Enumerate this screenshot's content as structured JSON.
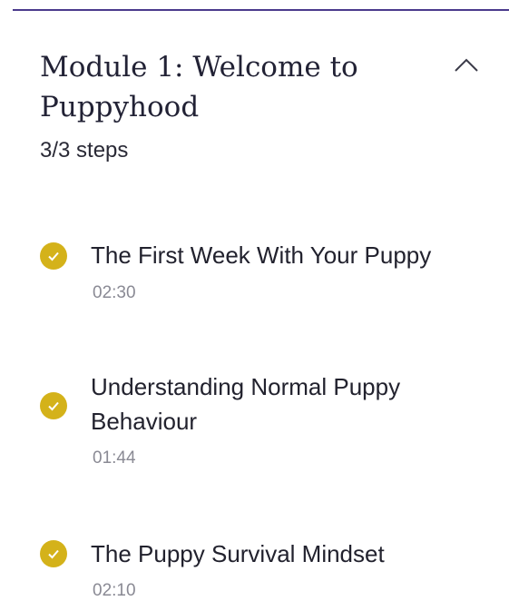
{
  "module": {
    "title": "Module 1: Welcome to Puppyhood",
    "steps": "3/3 steps",
    "toggle_icon": "chevron-up-icon"
  },
  "lessons": [
    {
      "title": "The First Week With Your Puppy",
      "duration": "02:30",
      "completed": true
    },
    {
      "title": "Understanding Normal Puppy Behaviour",
      "duration": "01:44",
      "completed": true
    },
    {
      "title": "The Puppy Survival Mindset",
      "duration": "02:10",
      "completed": true
    }
  ],
  "colors": {
    "accent_rule": "#4b3a8c",
    "check": "#d4b21a",
    "muted_text": "#8a8a94"
  }
}
